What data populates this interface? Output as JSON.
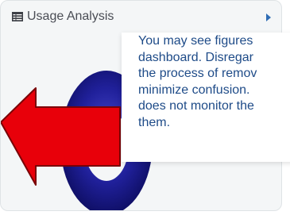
{
  "widget": {
    "title": "Usage Analysis",
    "title_icon": "table-icon",
    "corner_icon": "info-icon"
  },
  "chart": {
    "type": "donut",
    "ring_color": "#1a1a8c"
  },
  "overlay_arrow": {
    "color": "#e8000a",
    "direction": "left"
  },
  "notice": {
    "lines": [
      "You may see figures",
      "dashboard. Disregar",
      "the process of remov",
      "minimize confusion.",
      "does not monitor the",
      "them."
    ],
    "text_color": "#1e4b88"
  }
}
